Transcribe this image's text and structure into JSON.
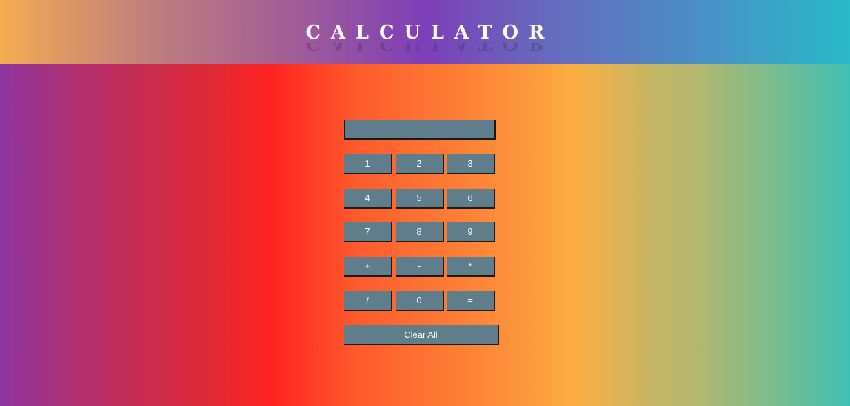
{
  "header": {
    "title": "CALCULATOR"
  },
  "display": {
    "value": ""
  },
  "keypad": {
    "rows": [
      [
        "1",
        "2",
        "3"
      ],
      [
        "4",
        "5",
        "6"
      ],
      [
        "7",
        "8",
        "9"
      ],
      [
        "+",
        "-",
        "*"
      ],
      [
        "/",
        "0",
        "="
      ]
    ],
    "clear_label": "Clear All"
  },
  "colors": {
    "button_bg": "#607d8b",
    "button_text": "#ffffff",
    "header_gradient": [
      "#f4ac52",
      "#7d3fb8",
      "#29b9c8"
    ],
    "body_gradient": [
      "#8e36a0",
      "#ff2320",
      "#fbaf44",
      "#40c0b4"
    ]
  }
}
